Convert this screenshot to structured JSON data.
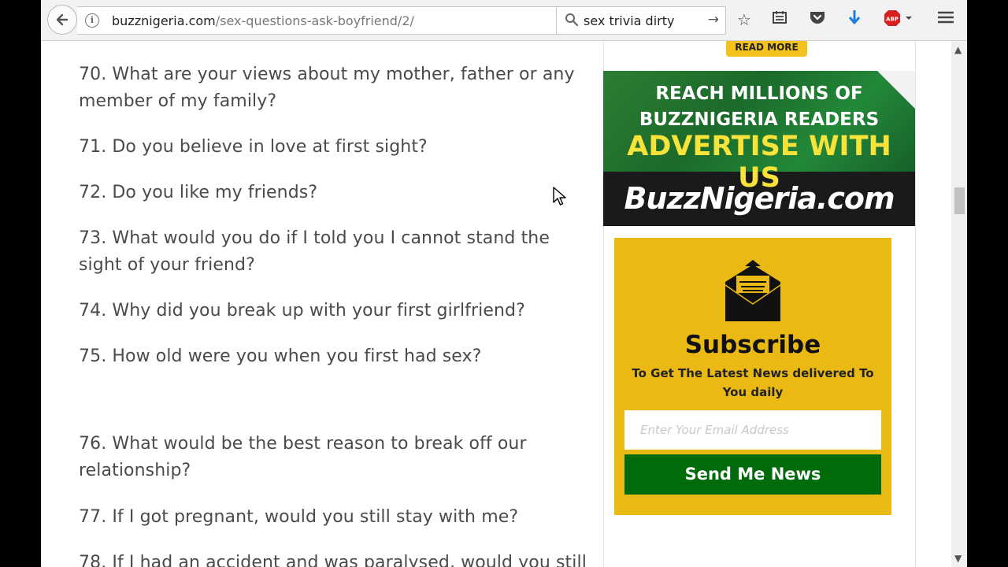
{
  "browser": {
    "url_domain": "buzznigeria.com",
    "url_path": "/sex-questions-ask-boyfriend/2/",
    "search_value": "sex trivia dirty",
    "adblock_label": "ABP"
  },
  "article": {
    "questions": [
      "70. What are your views about my mother, father or any member of my family?",
      "71. Do you believe in love at first sight?",
      "72. Do you like my friends?",
      "73. What would you do if I told you I cannot stand the sight of your friend?",
      "74. Why did you break up with your first girlfriend?",
      "75. How old were you when you first had sex?",
      "76. What would be the best reason to break off our relationship?",
      "77. If I got pregnant, would you still stay with me?",
      "78. If I had an accident and was paralysed, would you still"
    ]
  },
  "sidebar": {
    "read_more": "READ MORE",
    "ad": {
      "line1": "REACH MILLIONS OF",
      "line2": "BUZZNIGERIA READERS",
      "line3": "ADVERTISE WITH US",
      "logo": "BuzzNigeria.com"
    },
    "subscribe": {
      "title": "Subscribe",
      "description": "To Get The Latest News delivered To You daily",
      "email_placeholder": "Enter Your Email Address",
      "button_label": "Send Me News"
    }
  },
  "colors": {
    "subscribe_bg": "#eab913",
    "send_button": "#006b0a",
    "ad_green": "#1f6a2a",
    "ad_yellow_text": "#f7e33a"
  }
}
